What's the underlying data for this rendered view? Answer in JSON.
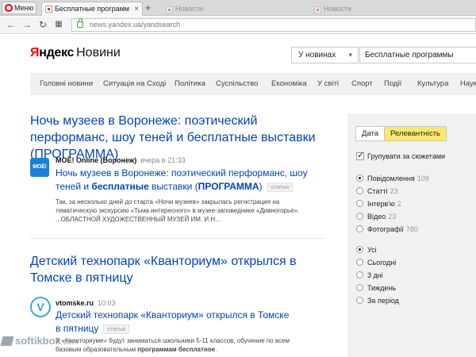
{
  "browser": {
    "menu_label": "Меню",
    "tabs": [
      {
        "title": "Бесплатные программ"
      },
      {
        "title": "Новости"
      },
      {
        "title": "Новости"
      }
    ],
    "new_tab_label": "+",
    "url_host": "news.yandex.ua",
    "url_path": "/yandsearch"
  },
  "header": {
    "logo_ya_first": "Я",
    "logo_ya_rest": "ндекс",
    "logo_product": "Новини",
    "scope_value": "У новинах",
    "search_value": "Бесплатные программы"
  },
  "categories": [
    "Головні новини",
    "Ситуація на Сході",
    "Політика",
    "Суспільство",
    "Економіка",
    "У світі",
    "Спорт",
    "Події",
    "Культура",
    "Наук"
  ],
  "results": [
    {
      "title": "Ночь музеев в Воронеже: поэтический перформанс, шоу теней и бесплатные выставки (ПРОГРАММА)",
      "logo_text": "МОЁ!",
      "source": "МОЁ! Online (Воронеж)",
      "time": "вчера в 21:33",
      "sub_title_a": "Ночь музеев в Воронеже: поэтический перформанс, шоу теней и ",
      "sub_title_b": "бесплатные",
      "sub_title_c": " выставки (",
      "sub_title_d": "ПРОГРАММА",
      "sub_title_e": ")",
      "tag": "статья",
      "snippet": "Так, за несколько дней до старта «Ночи музеев» закрылась регистрация на тематическую экскурсию «Тьма интересного» в музее-заповеднике «Дивногорье». ...ОБЛАСТНОЙ ХУДОЖЕСТВЕННЫЙ МУЗЕЙ ИМ. И.Н..."
    },
    {
      "title": "Детский технопарк «Кванториум» открылся в Томске в пятницу",
      "logo_text": "V",
      "source": "vtomske.ru",
      "time": "10:03",
      "sub_title": "Детский технопарк «Кванториум» открылся в Томске в пятницу",
      "tag": "статья",
      "snippet_a": "В «Кванториуме» будут заниматься школьники 5-11 классов, обучение по всем базовым образовательным ",
      "snippet_b": "программам бесплатное",
      "snippet_c": "."
    }
  ],
  "sidebar": {
    "sort_date": "Дата",
    "sort_relevance": "Релевантність",
    "group_label": "Групувати за сюжетами",
    "types": [
      {
        "label": "Повідомлення",
        "count": "109"
      },
      {
        "label": "Статті",
        "count": "23"
      },
      {
        "label": "Інтерв'ю",
        "count": "2"
      },
      {
        "label": "Відео",
        "count": "23"
      },
      {
        "label": "Фотографії",
        "count": "780"
      }
    ],
    "periods": [
      "Усі",
      "Сьогодні",
      "3 дні",
      "Тиждень",
      "За період"
    ]
  },
  "watermark": {
    "text": "softikbox",
    "domain": ".com"
  },
  "colors": {
    "link": "#0044bb",
    "accent_yellow": "#fce86e",
    "yandex_red": "#ff0000"
  }
}
